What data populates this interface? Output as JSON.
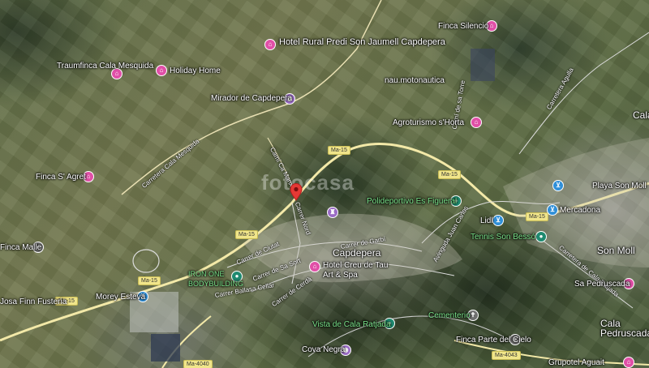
{
  "map": {
    "watermark": "fotocasa",
    "roads": {
      "ma15_a": "Ma-15",
      "ma15_b": "Ma-15",
      "ma15_c": "Ma-15",
      "ma15_d": "Ma-15",
      "ma15_e": "Ma-15",
      "ma4043": "Ma-4043",
      "ma4040": "Ma-4040"
    },
    "streets": {
      "mesquida": "Carretera Cala Mesquida",
      "ca_manxa": "Camí Ca Manxa",
      "nord": "Carrer Nord",
      "ciutat": "Carrer de Ciutat",
      "sa_sort": "Carrer de Sa Sort",
      "garbi": "Carrer de Garbí",
      "ballesa": "Carrer Ballasa Cellar",
      "cerdai": "Carrer de Cerdà",
      "juan_carlos": "Avinguda Juan Carlos",
      "garceta": "Carretera Agulla",
      "agulla": "Carretera Agulla",
      "ratjada": "Carretera de Cala Ratjada",
      "costa": "Camí de sa Torre"
    },
    "labels": {
      "hotel_rural": "Hotel Rural Predi Son Jaumell Capdepera",
      "finca_silencio": "Finca Silencio",
      "traumfinca": "Traumfinca Cala Mesquida",
      "holiday_home": "Holiday Home",
      "mirador": "Mirador de Capdepera",
      "nau": "nau.motonautica",
      "agroturismo": "Agroturismo s'Horta",
      "finca_agret": "Finca S' Agret",
      "polideportivo": "Polideportivo Es Figueral",
      "lidl": "Lidl",
      "playa": "Playa Son Moll",
      "mercadona": "Mercadona",
      "tennis": "Tennis Son Bessó",
      "capdepera": "Capdepera",
      "hotel_creu": "Hotel Creu de Tau Art & Spa",
      "iron": "IRON ONE BODYBUILDING",
      "cala_malle": "Finca Malle",
      "fusteria": "Josa Finn Fusteria",
      "morey": "Morey Esteva",
      "cementerio": "Cementerio",
      "vista": "Vista de Cala Ratjada",
      "finca_parte": "Finca Parte del Cielo",
      "cova_negra": "Cova Negra",
      "cala_ratjada": "Cala",
      "son_moll": "Son Moll",
      "sa_pedruscada": "Sa Pedruscada",
      "cala_pedruscada": "Cala Pedruscada",
      "grupotel": "Grupotel Aguait"
    }
  }
}
